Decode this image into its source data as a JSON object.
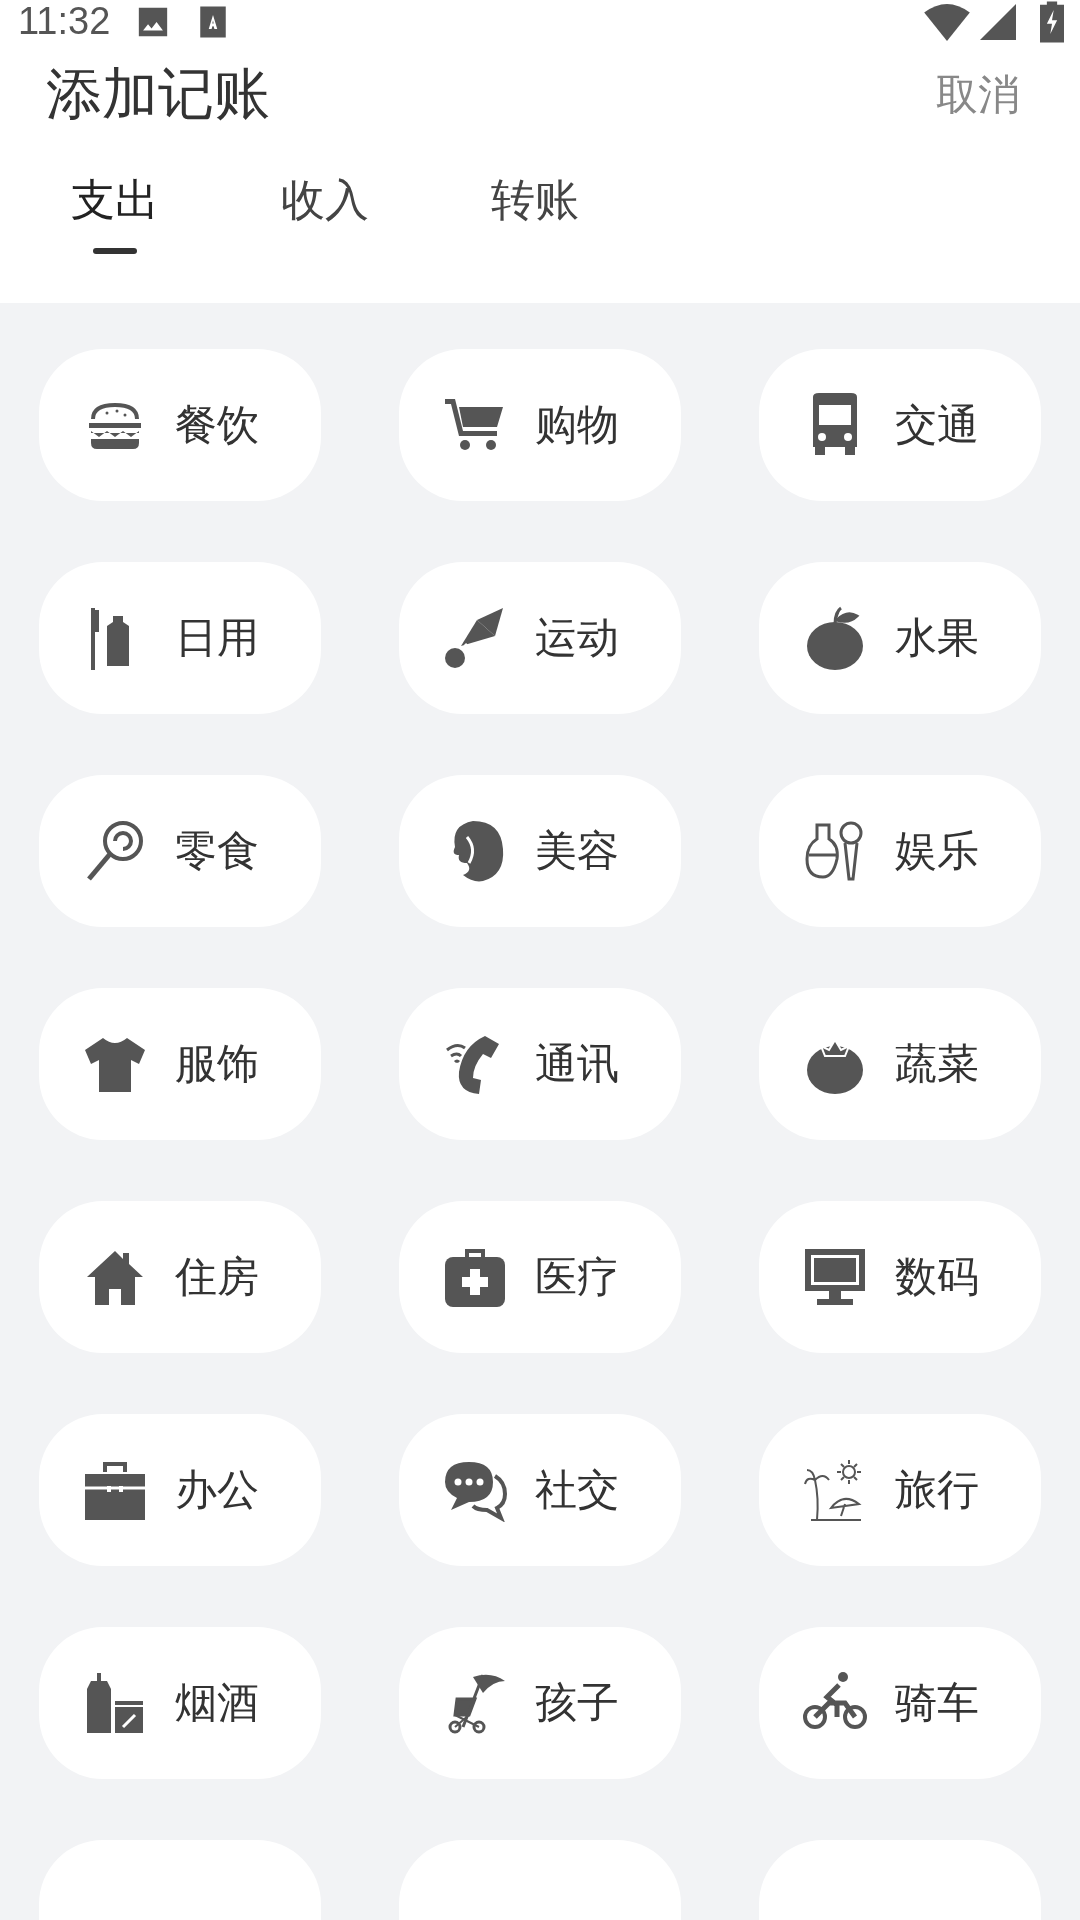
{
  "status_bar": {
    "time": "11:32"
  },
  "header": {
    "title": "添加记账",
    "cancel": "取消"
  },
  "tabs": [
    {
      "label": "支出",
      "selected": true
    },
    {
      "label": "收入",
      "selected": false
    },
    {
      "label": "转账",
      "selected": false
    }
  ],
  "categories": [
    {
      "kind": "full",
      "label": "餐饮"
    },
    {
      "kind": "full",
      "label": "购物"
    },
    {
      "kind": "full",
      "label": "交通"
    },
    {
      "kind": "full",
      "label": "日用"
    },
    {
      "kind": "full",
      "label": "运动"
    },
    {
      "kind": "full",
      "label": "水果"
    },
    {
      "kind": "full",
      "label": "零食"
    },
    {
      "kind": "full",
      "label": "美容"
    },
    {
      "kind": "full",
      "label": "娱乐"
    },
    {
      "kind": "full",
      "label": "服饰"
    },
    {
      "kind": "full",
      "label": "通讯"
    },
    {
      "kind": "full",
      "label": "蔬菜"
    },
    {
      "kind": "full",
      "label": "住房"
    },
    {
      "kind": "full",
      "label": "医疗"
    },
    {
      "kind": "full",
      "label": "数码"
    },
    {
      "kind": "full",
      "label": "办公"
    },
    {
      "kind": "full",
      "label": "社交"
    },
    {
      "kind": "full",
      "label": "旅行"
    },
    {
      "kind": "full",
      "label": "烟酒"
    },
    {
      "kind": "full",
      "label": "孩子"
    },
    {
      "kind": "full",
      "label": "骑车"
    },
    {
      "kind": "cut"
    },
    {
      "kind": "cut"
    },
    {
      "kind": "cut"
    }
  ]
}
